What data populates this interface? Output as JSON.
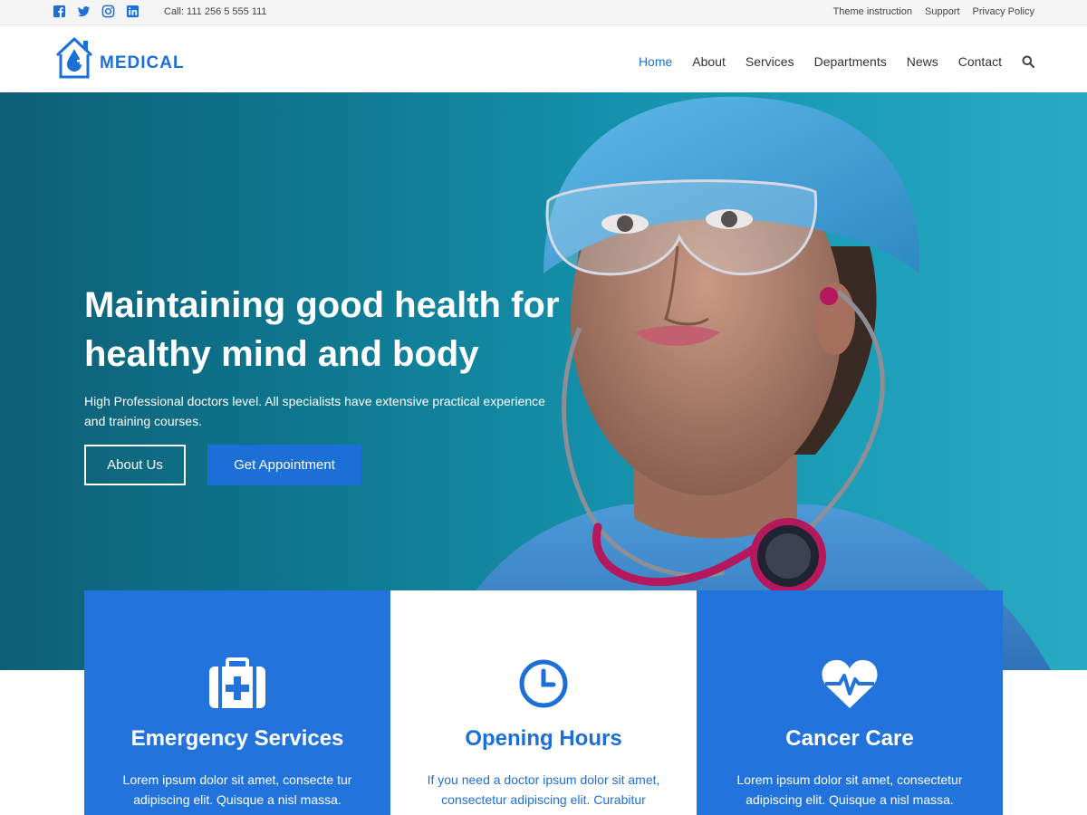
{
  "topbar": {
    "phone": "Call: 111 256 5 555 111",
    "social_icons": [
      "facebook-icon",
      "twitter-icon",
      "instagram-icon",
      "linkedin-icon"
    ],
    "links": [
      "Theme instruction",
      "Support",
      "Privacy Policy"
    ]
  },
  "header": {
    "logo_text": "MEDICAL",
    "nav": [
      "Home",
      "About",
      "Services",
      "Departments",
      "News",
      "Contact"
    ],
    "active": "Home"
  },
  "hero": {
    "title": "Maintaining good health for healthy mind and body",
    "subtitle": "High Professional doctors level. All specialists have extensive practical experience and training courses.",
    "btn_about": "About Us",
    "btn_appointment": "Get Appointment"
  },
  "cards": [
    {
      "title": "Emergency Services",
      "icon": "first-aid-kit-icon",
      "text": "Lorem ipsum dolor sit amet, consecte tur adipiscing elit. Quisque a nisl massa. Curabitur ultrices a eros eu fringilla."
    },
    {
      "title": "Opening Hours",
      "icon": "clock-icon",
      "text": "If you need a doctor ipsum dolor sit amet, consectetur adipiscing elit. Curabitur ultrices a eros eu fringilla."
    },
    {
      "title": "Cancer Care",
      "icon": "heart-pulse-icon",
      "text": "Lorem ipsum dolor sit amet, consectetur adipiscing elit. Quisque a nisl massa. Curabitur ultrices a eros eu fringilla."
    }
  ],
  "colors": {
    "brand": "#1d6fd8",
    "card_blue": "#2273dc",
    "hero_bg": "#0f7891"
  }
}
